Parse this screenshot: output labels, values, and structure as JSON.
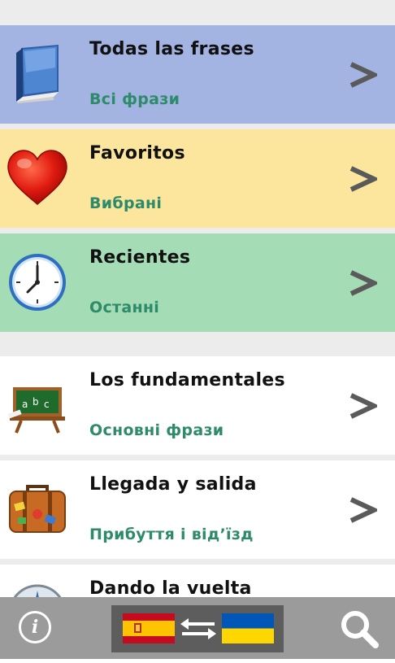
{
  "categories": [
    {
      "title": "Todas las frases",
      "subtitle": "Всі фрази",
      "icon": "book-icon",
      "bg": "#a3b3e2"
    },
    {
      "title": "Favoritos",
      "subtitle": "Вибрані",
      "icon": "heart-icon",
      "bg": "#fce59c"
    },
    {
      "title": "Recientes",
      "subtitle": "Останні",
      "icon": "clock-icon",
      "bg": "#a3dcb5"
    },
    {
      "title": "Los fundamentales",
      "subtitle": "Основні фрази",
      "icon": "chalkboard-icon",
      "bg": "#ffffff"
    },
    {
      "title": "Llegada y salida",
      "subtitle": "Прибуття і від’їзд",
      "icon": "suitcase-icon",
      "bg": "#ffffff"
    },
    {
      "title": "Dando la vuelta",
      "subtitle": "",
      "icon": "compass-icon",
      "bg": "#ffffff"
    }
  ],
  "chevron_symbol": ">",
  "bottombar": {
    "info_label": "i",
    "source_flag": "spain-flag-icon",
    "target_flag": "ukraine-flag-icon",
    "swap_icon": "swap-arrows-icon",
    "search_icon": "search-icon",
    "bg": "#9b9b9b"
  },
  "colors": {
    "subtitle": "#2e8b6a",
    "chevron": "#5a5a5a",
    "separator": "#ececec"
  }
}
